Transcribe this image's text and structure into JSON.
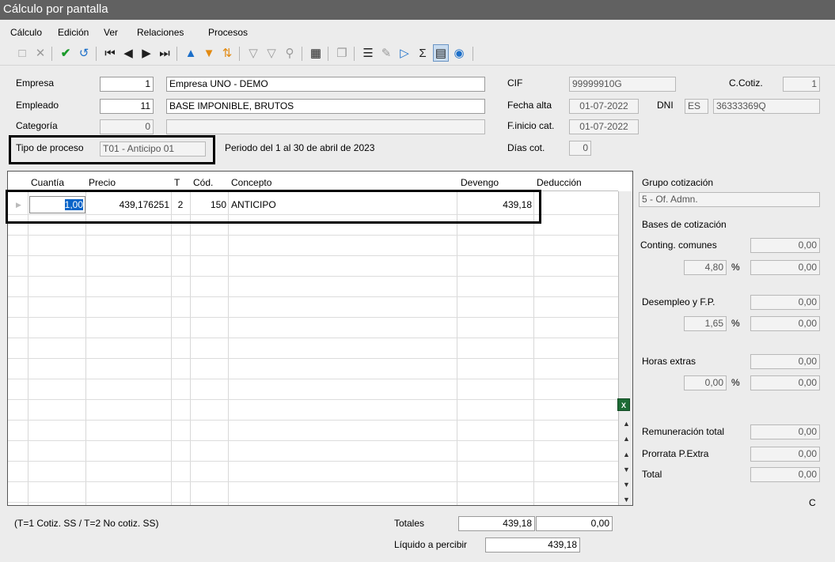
{
  "window": {
    "title": "Cálculo por pantalla"
  },
  "menu": [
    {
      "label": "Cálculo"
    },
    {
      "label": "Edición"
    },
    {
      "label": "Ver"
    },
    {
      "label": "Relaciones"
    },
    {
      "label": "Procesos"
    }
  ],
  "toolbar_icons": [
    "new-icon",
    "delete-icon",
    "confirm-icon",
    "undo-icon",
    "first-icon",
    "prev-icon",
    "next-icon",
    "last-icon",
    "move-up-icon",
    "move-down-icon",
    "sort-icon",
    "filter-icon",
    "clear-filter-icon",
    "search-icon",
    "table-icon",
    "copy-icon",
    "list-icon",
    "edit-icon",
    "import-icon",
    "sum-icon",
    "notes-icon",
    "preview-icon"
  ],
  "header": {
    "empresa_label": "Empresa",
    "empresa_code": "1",
    "empresa_name": "Empresa UNO - DEMO",
    "empleado_label": "Empleado",
    "empleado_code": "11",
    "empleado_name": "BASE IMPONIBLE, BRUTOS",
    "categoria_label": "Categoría",
    "categoria_code": "0",
    "categoria_name": "",
    "tipo_proceso_label": "Tipo de proceso",
    "tipo_proceso_value": "T01 - Anticipo 01",
    "periodo": "Periodo del 1 al 30 de abril de 2023",
    "cif_label": "CIF",
    "cif_value": "99999910G",
    "ccotiz_label": "C.Cotiz.",
    "ccotiz_value": "1",
    "fecha_alta_label": "Fecha alta",
    "fecha_alta_value": "01-07-2022",
    "dni_label": "DNI",
    "dni_country": "ES",
    "dni_value": "36333369Q",
    "finicio_label": "F.inicio cat.",
    "finicio_value": "01-07-2022",
    "dias_label": "Días cot.",
    "dias_value": "0"
  },
  "grid": {
    "columns": [
      "Cuantía",
      "Precio",
      "T",
      "Cód.",
      "Concepto",
      "Devengo",
      "Deducción"
    ],
    "rows": [
      {
        "cuantia": "1,00",
        "precio": "439,176251",
        "t": "2",
        "cod": "150",
        "concepto": "ANTICIPO",
        "devengo": "439,18",
        "deduccion": ""
      }
    ]
  },
  "side": {
    "grupo_label": "Grupo cotización",
    "grupo_value": "5 - Of. Admn.",
    "bases_label": "Bases de cotización",
    "conting_label": "Conting. comunes",
    "conting_value": "0,00",
    "conting_pct": "4,80",
    "conting_pct_value": "0,00",
    "desempleo_label": "Desempleo y F.P.",
    "desempleo_value": "0,00",
    "desempleo_pct": "1,65",
    "desempleo_pct_value": "0,00",
    "horas_label": "Horas extras",
    "horas_value": "0,00",
    "horas_pct": "0,00",
    "horas_pct_value": "0,00",
    "pct_symbol": "%",
    "remuneracion_label": "Remuneración total",
    "remuneracion_value": "0,00",
    "prorrata_label": "Prorrata P.Extra",
    "prorrata_value": "0,00",
    "total_label": "Total",
    "total_value": "0,00",
    "c_label": "C"
  },
  "footer": {
    "legend": "(T=1 Cotiz. SS / T=2 No cotiz. SS)",
    "totales_label": "Totales",
    "totales_devengo": "439,18",
    "totales_deduccion": "0,00",
    "liquido_label": "Líquido a percibir",
    "liquido_value": "439,18"
  }
}
